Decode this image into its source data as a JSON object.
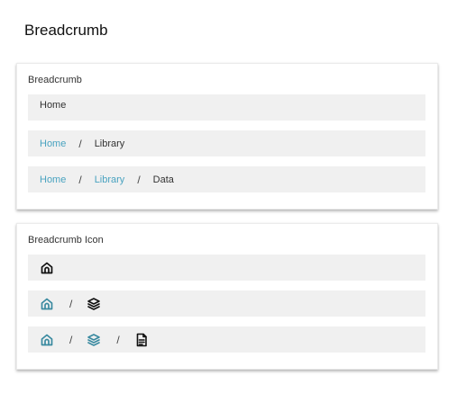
{
  "page": {
    "title": "Breadcrumb"
  },
  "colors": {
    "link": "#4aa3c0",
    "icon_link": "#3a8aa0",
    "bar_bg": "#f0f0f0"
  },
  "text_card": {
    "title": "Breadcrumb",
    "rows": [
      {
        "items": [
          "Home"
        ]
      },
      {
        "items": [
          "Home",
          "Library"
        ]
      },
      {
        "items": [
          "Home",
          "Library",
          "Data"
        ]
      }
    ],
    "separator": "/"
  },
  "icon_card": {
    "title": "Breadcrumb Icon",
    "rows": [
      {
        "icons": [
          "home-icon"
        ]
      },
      {
        "icons": [
          "home-icon",
          "layers-icon"
        ]
      },
      {
        "icons": [
          "home-icon",
          "layers-icon",
          "document-icon"
        ]
      }
    ],
    "separator": "/"
  }
}
